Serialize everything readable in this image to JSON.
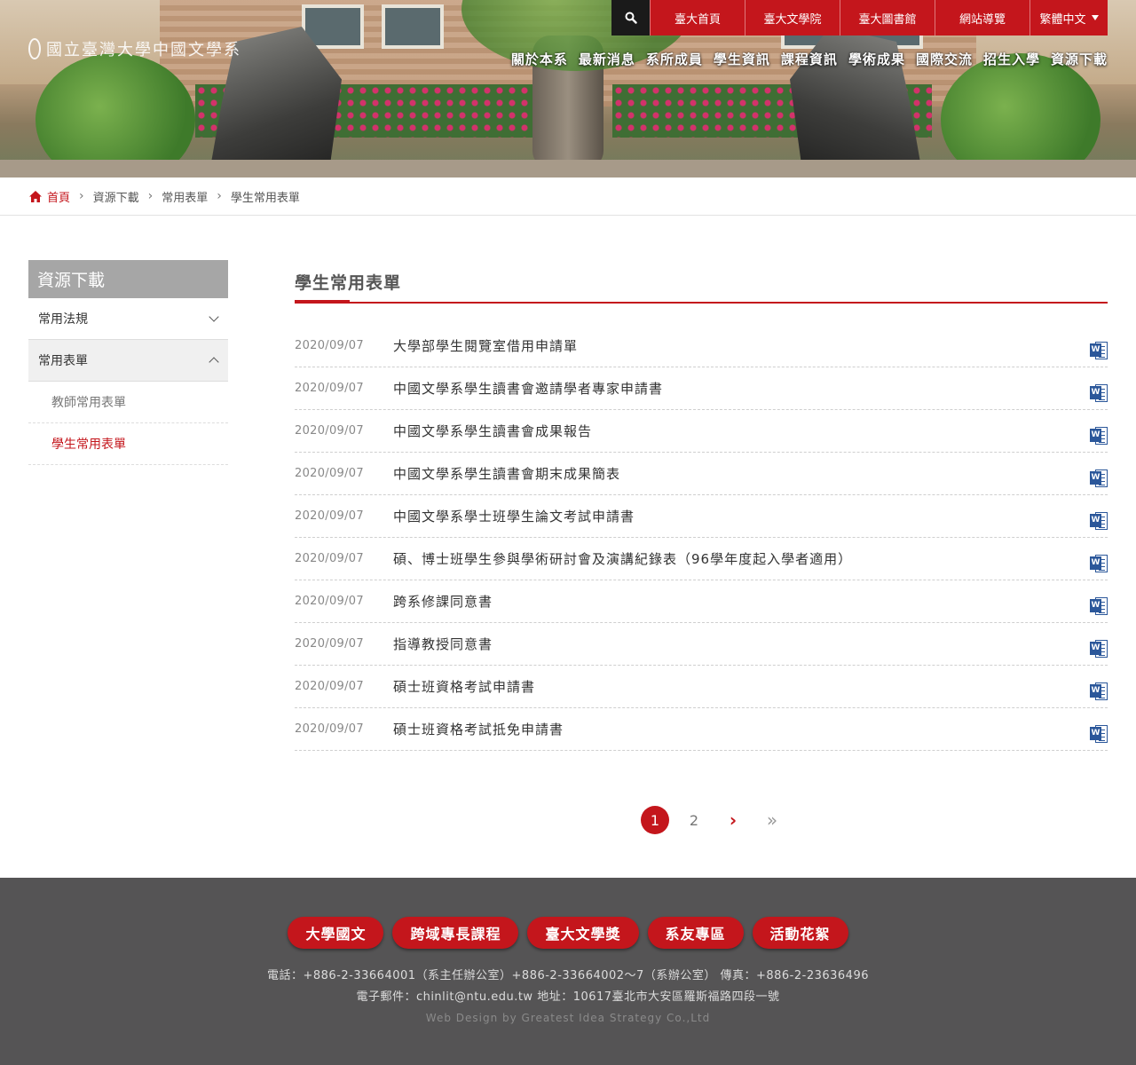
{
  "header": {
    "logo_text": "國立臺灣大學中國文學系",
    "top_links": [
      "臺大首頁",
      "臺大文學院",
      "臺大圖書館",
      "網站導覽"
    ],
    "language": "繁體中文",
    "nav": [
      "關於本系",
      "最新消息",
      "系所成員",
      "學生資訊",
      "課程資訊",
      "學術成果",
      "國際交流",
      "招生入學",
      "資源下載"
    ]
  },
  "breadcrumb": [
    "首頁",
    "資源下載",
    "常用表單",
    "學生常用表單"
  ],
  "sidebar": {
    "title": "資源下載",
    "items": [
      {
        "label": "常用法規"
      },
      {
        "label": "常用表單"
      }
    ],
    "sub_items": [
      {
        "label": "教師常用表單"
      },
      {
        "label": "學生常用表單"
      }
    ]
  },
  "main": {
    "title": "學生常用表單",
    "documents": [
      {
        "date": "2020/09/07",
        "title": "大學部學生閱覽室借用申請單"
      },
      {
        "date": "2020/09/07",
        "title": "中國文學系學生讀書會邀請學者專家申請書"
      },
      {
        "date": "2020/09/07",
        "title": "中國文學系學生讀書會成果報告"
      },
      {
        "date": "2020/09/07",
        "title": "中國文學系學生讀書會期末成果簡表"
      },
      {
        "date": "2020/09/07",
        "title": "中國文學系學士班學生論文考試申請書"
      },
      {
        "date": "2020/09/07",
        "title": "碩、博士班學生參與學術研討會及演講紀錄表（96學年度起入學者適用）"
      },
      {
        "date": "2020/09/07",
        "title": "跨系修課同意書"
      },
      {
        "date": "2020/09/07",
        "title": "指導教授同意書"
      },
      {
        "date": "2020/09/07",
        "title": "碩士班資格考試申請書"
      },
      {
        "date": "2020/09/07",
        "title": "碩士班資格考試抵免申請書"
      }
    ],
    "file_icon": "word-doc-icon"
  },
  "pagination": {
    "pages": [
      "1",
      "2"
    ],
    "current": "1",
    "next": "›",
    "last": "»"
  },
  "footer": {
    "buttons": [
      "大學國文",
      "跨域專長課程",
      "臺大文學獎",
      "系友專區",
      "活動花絮"
    ],
    "phone_line": "電話：+886-2-33664001（系主任辦公室）+886-2-33664002～7（系辦公室） 傳真：+886-2-23636496",
    "email_line": "電子郵件：chinlit@ntu.edu.tw 地址：10617臺北市大安區羅斯福路四段一號",
    "credit": "Web Design by Greatest Idea Strategy Co.,Ltd"
  },
  "colors": {
    "accent": "#c4161c",
    "footer_bg": "#555455",
    "sidebar_title_bg": "#a6a6a6"
  }
}
